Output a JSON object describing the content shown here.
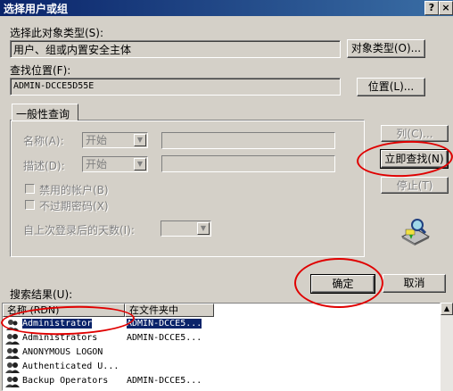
{
  "window": {
    "title": "选择用户或组",
    "help_glyph": "?",
    "close_glyph": "×"
  },
  "object_type": {
    "label": "选择此对象类型(S):",
    "value": "用户、组或内置安全主体",
    "button": "对象类型(O)..."
  },
  "location": {
    "label": "查找位置(F):",
    "value": "ADMIN-DCCE5D55E",
    "button": "位置(L)..."
  },
  "general_query": {
    "tab": "一般性查询",
    "name_label": "名称(A):",
    "name_op": "开始",
    "desc_label": "描述(D):",
    "desc_op": "开始",
    "disabled_accounts": "禁用的帐户(B)",
    "non_expiring_pw": "不过期密码(X)",
    "days_since_logon": "自上次登录后的天数(I):"
  },
  "side_buttons": {
    "columns": "列(C)...",
    "find_now": "立即查找(N)",
    "stop": "停止(T)"
  },
  "dialog_buttons": {
    "ok": "确定",
    "cancel": "取消"
  },
  "results": {
    "label": "搜索结果(U):",
    "columns": [
      "名称 (RDN)",
      "在文件夹中"
    ],
    "rows": [
      {
        "name": "Administrator",
        "folder": "ADMIN-DCCE5...",
        "selected": true
      },
      {
        "name": "Administrators",
        "folder": "ADMIN-DCCE5...",
        "selected": false
      },
      {
        "name": "ANONYMOUS LOGON",
        "folder": "",
        "selected": false
      },
      {
        "name": "Authenticated U...",
        "folder": "",
        "selected": false
      },
      {
        "name": "Backup Operators",
        "folder": "ADMIN-DCCE5...",
        "selected": false
      }
    ]
  },
  "colors": {
    "title_bar": "#0a246a",
    "face": "#d4d0c8",
    "selection": "#0a246a",
    "annotation": "#e00000"
  }
}
